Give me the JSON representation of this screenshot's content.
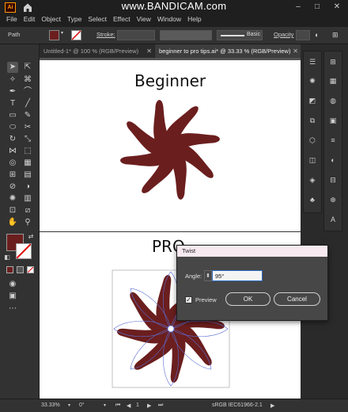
{
  "app": {
    "logo_text": "Ai"
  },
  "watermark": "www.BANDICAM.com",
  "menu": [
    "File",
    "Edit",
    "Object",
    "Type",
    "Select",
    "Effect",
    "View",
    "Window",
    "Help"
  ],
  "control_bar": {
    "selection_label": "Path",
    "stroke_label": "Stroke:",
    "brush_label": "Basic",
    "opacity_label": "Opacity",
    "fill_color": "#6b1e1e"
  },
  "tabs": [
    {
      "label": "Untitled-1* @ 100 % (RGB/Preview)"
    },
    {
      "label": "beginner to pro tips.ai* @ 33.33 % (RGB/Preview)"
    }
  ],
  "artboards": {
    "top_heading": "Beginner",
    "bottom_heading": "PRO"
  },
  "shape_color": "#6b1e1e",
  "twist_dialog": {
    "title": "Twist",
    "angle_label": "Angle:",
    "angle_value": "95°",
    "preview_label": "Preview",
    "preview_checked": true,
    "ok_label": "OK",
    "cancel_label": "Cancel"
  },
  "status_bar": {
    "zoom": "33.33%",
    "rotation": "0°",
    "artboard_number": "1",
    "color_profile": "sRGB IEC61966-2.1"
  }
}
